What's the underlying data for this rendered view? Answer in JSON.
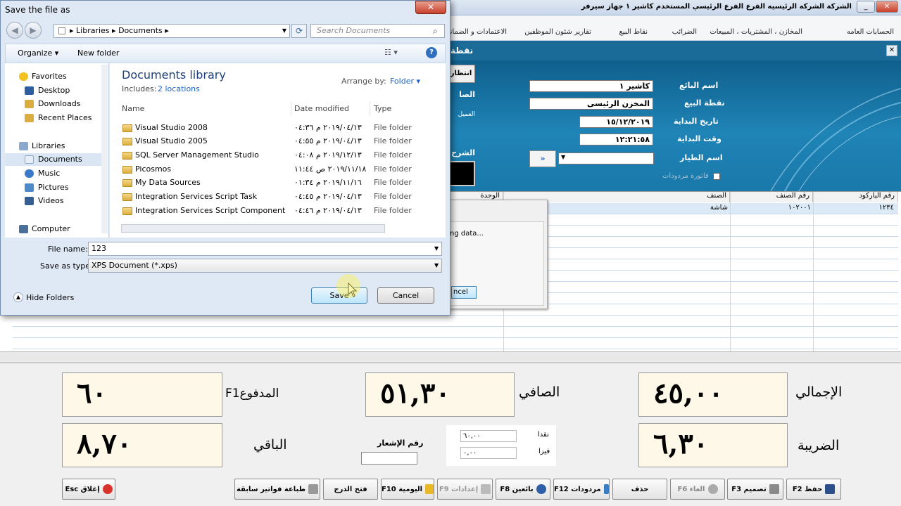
{
  "app": {
    "title": "الشركة الشركه الرئيسيه   الفرع الفرع الرئيسي   المستخدم كاشير ١   جهاز سيرفر",
    "menu": [
      "الحسابات العامه",
      "المخازن ، المشتريات ، المبيعات",
      "الضرائب",
      "نقاط البيع",
      "تقارير شئون الموظفين",
      "الاعتمادات و الضمانات"
    ],
    "banner_partial": "نقطة",
    "fields": [
      {
        "label": "اسم البائع",
        "value": "كاشير ١"
      },
      {
        "label": "نقطة البيع",
        "value": "المخزن الرئيسى"
      },
      {
        "label": "تاريخ البداية",
        "value": "١٥/١٢/٢٠١٩"
      },
      {
        "label": "وقت البداية",
        "value": "١٢:٢١:٥٨"
      },
      {
        "label": "اسم الطيار",
        "value": ""
      }
    ],
    "returns_checkbox": "فاتورة مردودات",
    "partial_labels": [
      "انتظار",
      "الصا",
      "العميل",
      "الشرح"
    ],
    "grid_headers": [
      "رقم الباركود",
      "رقم الصنف",
      "الصنف",
      "الوحدة"
    ],
    "grid_row": {
      "barcode": "١٢٣٤",
      "item_no": "١٠٢٠٠١",
      "item": "شاشة"
    },
    "progress_text": "ng data...",
    "progress_cancel": "ncel",
    "totals": {
      "total_label": "الإجمالي",
      "total_value": "٤٥,٠٠",
      "net_label": "الصافي",
      "net_value": "٥١,٣٠",
      "paid_label": "المدفوعF1",
      "paid_value": "٦٠",
      "tax_label": "الضريبة",
      "tax_value": "٦,٣٠",
      "remain_label": "الباقي",
      "remain_value": "٨,٧٠",
      "notice_label": "رقم الإشعار",
      "cash_label": "نقدا",
      "cash_value": "٦٠,٠٠",
      "visa_label": "فيزا",
      "visa_value": "٠,٠٠"
    },
    "footer_buttons": [
      "حفظ F2",
      "تصميم F3",
      "الغاء F6",
      "حذف",
      "مردودات F12",
      "بائعين F8",
      "إعدادات F9",
      "اليومية F10",
      "فتح الدرج",
      "طباعة فواتير سابقة",
      "إغلاق Esc"
    ]
  },
  "dialog": {
    "title": "Save the file as",
    "breadcrumb": [
      "Libraries",
      "Documents"
    ],
    "search_placeholder": "Search Documents",
    "organize": "Organize",
    "new_folder": "New folder",
    "nav": {
      "favorites": "Favorites",
      "favorites_items": [
        "Desktop",
        "Downloads",
        "Recent Places"
      ],
      "libraries": "Libraries",
      "libraries_items": [
        "Documents",
        "Music",
        "Pictures",
        "Videos"
      ],
      "computer": "Computer"
    },
    "library_title": "Documents library",
    "includes_label": "Includes:",
    "includes_link": "2 locations",
    "arrange_label": "Arrange by:",
    "arrange_value": "Folder",
    "columns": [
      "Name",
      "Date modified",
      "Type"
    ],
    "files": [
      {
        "name": "Visual Studio 2008",
        "date": "٢٠١٩/٠٤/١٣ م ٠٤:٣٦",
        "type": "File folder"
      },
      {
        "name": "Visual Studio 2005",
        "date": "٢٠١٩/٠٤/١٣ م ٠٤:٥٥",
        "type": "File folder"
      },
      {
        "name": "SQL Server Management Studio",
        "date": "٢٠١٩/١٢/١٣ م ٠٤:٠٨",
        "type": "File folder"
      },
      {
        "name": "Picosmos",
        "date": "٢٠١٩/١١/١٨ ص ١١:٤٤",
        "type": "File folder"
      },
      {
        "name": "My Data Sources",
        "date": "٢٠١٩/١١/١٦ م ٠١:٣٤",
        "type": "File folder"
      },
      {
        "name": "Integration Services Script Task",
        "date": "٢٠١٩/٠٤/١٣ م ٠٤:٤٥",
        "type": "File folder"
      },
      {
        "name": "Integration Services Script Component",
        "date": "٢٠١٩/٠٤/١٣ م ٠٤:٤٦",
        "type": "File folder"
      }
    ],
    "filename_label": "File name:",
    "filename_value": "123",
    "savetype_label": "Save as type:",
    "savetype_value": "XPS Document (*.xps)",
    "hide_folders": "Hide Folders",
    "save": "Save",
    "cancel": "Cancel"
  }
}
